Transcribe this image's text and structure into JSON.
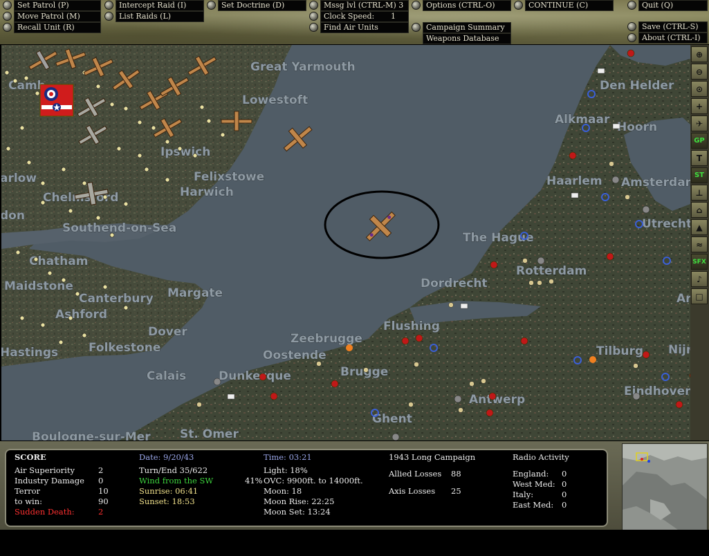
{
  "menu": {
    "set_patrol": "Set Patrol (P)",
    "move_patrol": "Move Patrol (M)",
    "recall_unit": "Recall Unit (R)",
    "intercept_raid": "Intercept Raid (I)",
    "list_raids": "List Raids (L)",
    "set_doctrine": "Set Doctrine (D)",
    "msg_level": "Mssg lvl (CTRL-M)  3",
    "clock_speed_label": "Clock Speed:",
    "clock_speed_value": "1",
    "find_air_units": "Find Air Units",
    "options": "Options (CTRL-O)",
    "campaign_summary": "Campaign Summary",
    "weapons_database": "Weapons Database",
    "continue": "CONTINUE (C)",
    "quit": "Quit (Q)",
    "save": "Save (CTRL-S)",
    "about": "About (CTRL-I)"
  },
  "map": {
    "places": [
      "Great Yarmouth",
      "Lowestoft",
      "Ipswich",
      "Felixstowe",
      "Harwich",
      "Chelmsford",
      "Southend-on-Sea",
      "Chatham",
      "Maidstone",
      "Canterbury",
      "Margate",
      "Ashford",
      "Dover",
      "Folkestone",
      "Hastings",
      "Den Helder",
      "Alkmaar",
      "Hoorn",
      "Haarlem",
      "Amsterdam",
      "Utrecht",
      "The Hague",
      "Rotterdam",
      "Dordrecht",
      "Flushing",
      "Zeebrugge",
      "Oostende",
      "Brugge",
      "Dunkerque",
      "Calais",
      "Boulogne-sur-Mer",
      "St. Omer",
      "Antwerp",
      "Ghent",
      "Tilburg",
      "Eindhoven",
      "Nijm",
      "Camb",
      "arlow",
      "don",
      "Arn"
    ],
    "selected_unit_icon": "bomber-aircraft-icon",
    "squadron_flag_icon": "raf-roundel-flag-icon"
  },
  "toolbar": {
    "buttons": [
      "zoom-in-icon",
      "zoom-out-icon",
      "center-icon",
      "grid-icon",
      "aircraft-icon",
      "GP",
      "T",
      "ST",
      "radar-icon",
      "factory-icon",
      "city-icon",
      "ship-icon",
      "SFX",
      "music-icon",
      "map-icon"
    ],
    "gp_label": "GP",
    "t_label": "T",
    "st_label": "ST",
    "sfx_label": "SFX"
  },
  "status": {
    "score_title": "SCORE",
    "air_superiority_label": "Air Superiority",
    "air_superiority_value": "2",
    "industry_damage_label": "Industry Damage",
    "industry_damage_value": "0",
    "terror_label": "Terror",
    "terror_value": "10",
    "to_win_label": "to win:",
    "to_win_value": "90",
    "sudden_death_label": "Sudden Death:",
    "sudden_death_value": "2",
    "date": "Date: 9/20/43",
    "turn_end": "Turn/End  35/622",
    "wind": "Wind from the SW",
    "sunrise": "Sunrise: 06:41",
    "sunset": "Sunset: 18:53",
    "time": "Time: 03:21",
    "light": "Light: 18%",
    "ovc_pct": "41%",
    "ovc": "OVC: 9900ft. to 14000ft.",
    "moon": "Moon: 18",
    "moon_rise": "Moon Rise: 22:25",
    "moon_set": "Moon Set: 13:24",
    "campaign": "1943 Long Campaign",
    "allied_losses_label": "Allied Losses",
    "allied_losses_value": "88",
    "axis_losses_label": "Axis Losses",
    "axis_losses_value": "25",
    "radio_title": "Radio Activity",
    "radio": [
      {
        "label": "England:",
        "value": "0"
      },
      {
        "label": "West Med:",
        "value": "0"
      },
      {
        "label": "Italy:",
        "value": "0"
      },
      {
        "label": "East Med:",
        "value": "0"
      }
    ]
  },
  "colors": {
    "sea": "#4f5a63",
    "land": "#454a3a",
    "text_blue": "#9aa6e8",
    "text_green": "#3ed63e",
    "text_red": "#ff3030"
  }
}
